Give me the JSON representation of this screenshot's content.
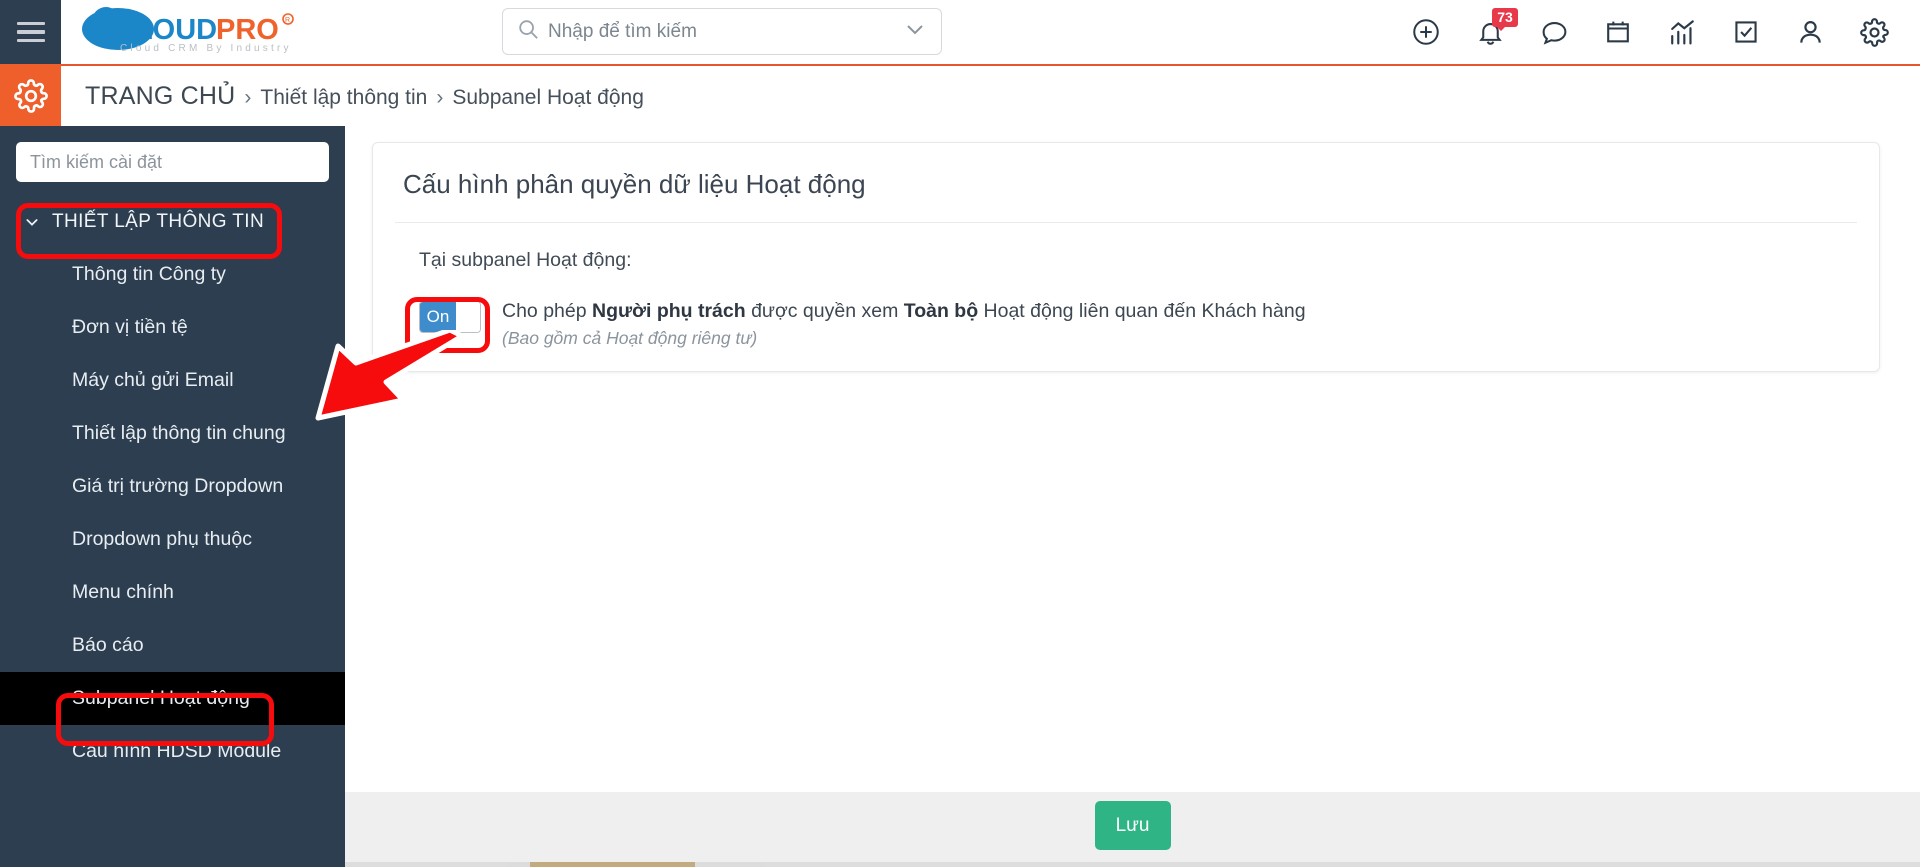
{
  "colors": {
    "sidebar_bg": "#2d3e50",
    "header_dark": "#2d3e50",
    "accent_orange": "#ef5f2b",
    "badge_red": "#e8394a",
    "toggle_blue": "#3e8ccc",
    "save_green": "#2fb485",
    "annotation_red": "#f60c0c",
    "active_item_bg": "#000000"
  },
  "header": {
    "menu_icon": "hamburger-icon",
    "logo": {
      "cloud_text": "CLOUD",
      "pro_text": "PRO",
      "registered_mark": "®",
      "tagline": "Cloud  CRM  By  Industry"
    },
    "search": {
      "placeholder": "Nhập để tìm kiếm",
      "value": "",
      "icon": "search-icon",
      "caret_icon": "chevron-down-icon"
    },
    "icons": [
      {
        "name": "add-circle-icon",
        "label": "Thêm mới"
      },
      {
        "name": "bell-icon",
        "label": "Thông báo",
        "badge": "73"
      },
      {
        "name": "chat-icon",
        "label": "Tin nhắn"
      },
      {
        "name": "calendar-icon",
        "label": "Lịch"
      },
      {
        "name": "chart-icon",
        "label": "Báo cáo"
      },
      {
        "name": "checkbox-icon",
        "label": "Công việc"
      },
      {
        "name": "user-icon",
        "label": "Tài khoản"
      },
      {
        "name": "gear-icon",
        "label": "Cài đặt"
      }
    ]
  },
  "breadcrumb": {
    "settings_icon": "gear-icon",
    "items": [
      {
        "label": "TRANG CHỦ",
        "current": false
      },
      {
        "label": "Thiết lập thông tin",
        "current": false
      },
      {
        "label": "Subpanel Hoạt động",
        "current": true
      }
    ],
    "separator": "›"
  },
  "sidebar": {
    "search": {
      "placeholder": "Tìm kiếm cài đặt",
      "value": ""
    },
    "group": {
      "label": "THIẾT LẬP THÔNG TIN",
      "expanded": true,
      "chevron_icon": "chevron-down-icon"
    },
    "items": [
      {
        "label": "Thông tin Công ty",
        "active": false
      },
      {
        "label": "Đơn vị tiền tệ",
        "active": false
      },
      {
        "label": "Máy chủ gửi Email",
        "active": false
      },
      {
        "label": "Thiết lập thông tin chung",
        "active": false
      },
      {
        "label": "Giá trị trường Dropdown",
        "active": false
      },
      {
        "label": "Dropdown phụ thuộc",
        "active": false
      },
      {
        "label": "Menu chính",
        "active": false
      },
      {
        "label": "Báo cáo",
        "active": false
      },
      {
        "label": "Subpanel Hoạt động",
        "active": true
      },
      {
        "label": "Cấu hình HDSD Module",
        "active": false
      }
    ]
  },
  "main": {
    "card_title": "Cấu hình phân quyền dữ liệu Hoạt động",
    "section_label": "Tại subpanel Hoạt động:",
    "toggle": {
      "state": "On",
      "on_label": "On",
      "checked": true
    },
    "permission_text": {
      "part1": "Cho phép ",
      "bold1": "Người phụ trách",
      "part2": " được quyền xem ",
      "bold2": "Toàn bộ",
      "part3": " Hoạt động liên quan đến Khách hàng",
      "note": "(Bao gồm cả Hoạt động riêng tư)"
    }
  },
  "footer": {
    "save_label": "Lưu"
  },
  "annotations": [
    {
      "name": "annotation-box-settings-group",
      "shape": "rounded-rect"
    },
    {
      "name": "annotation-box-active-item",
      "shape": "rounded-rect"
    },
    {
      "name": "annotation-box-toggle",
      "shape": "rounded-rect"
    },
    {
      "name": "annotation-arrow-toggle",
      "shape": "arrow"
    }
  ]
}
